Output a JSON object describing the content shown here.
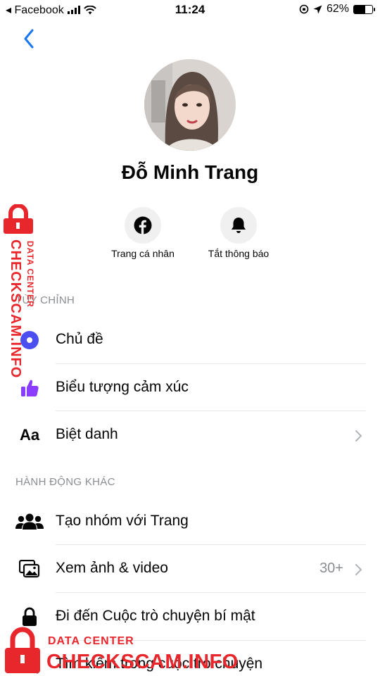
{
  "status_bar": {
    "back_app": "◂ Facebook",
    "time": "11:24",
    "battery": "62%"
  },
  "profile": {
    "name": "Đỗ Minh Trang",
    "actions": [
      {
        "label": "Trang cá nhân",
        "icon": "facebook-icon"
      },
      {
        "label": "Tắt thông báo",
        "icon": "bell-icon"
      }
    ]
  },
  "sections": {
    "customize_header": "TÙY CHỈNH",
    "other_actions_header": "HÀNH ĐỘNG KHÁC"
  },
  "customize_items": [
    {
      "label": "Chủ đề",
      "icon": "theme-icon"
    },
    {
      "label": "Biểu tượng cảm xúc",
      "icon": "thumbs-up-icon"
    },
    {
      "label": "Biệt danh",
      "icon": "nickname-icon",
      "glyph": "Aa"
    }
  ],
  "other_items": [
    {
      "label": "Tạo nhóm với Trang",
      "icon": "group-icon"
    },
    {
      "label": "Xem ảnh & video",
      "icon": "media-icon",
      "value": "30+"
    },
    {
      "label": "Đi đến Cuộc trò chuyện bí mật",
      "icon": "lock-icon"
    },
    {
      "label": "Tìm kiếm trong cuộc trò chuyện",
      "icon": "search-icon"
    }
  ],
  "watermark": {
    "line1": "DATA CENTER",
    "line2": "CHECKSCAM.INFO"
  },
  "colors": {
    "accent": "#1877f2",
    "theme_ring": "#4b4ff0",
    "thumbs_up": "#8b3dff",
    "watermark": "#e8272d"
  }
}
